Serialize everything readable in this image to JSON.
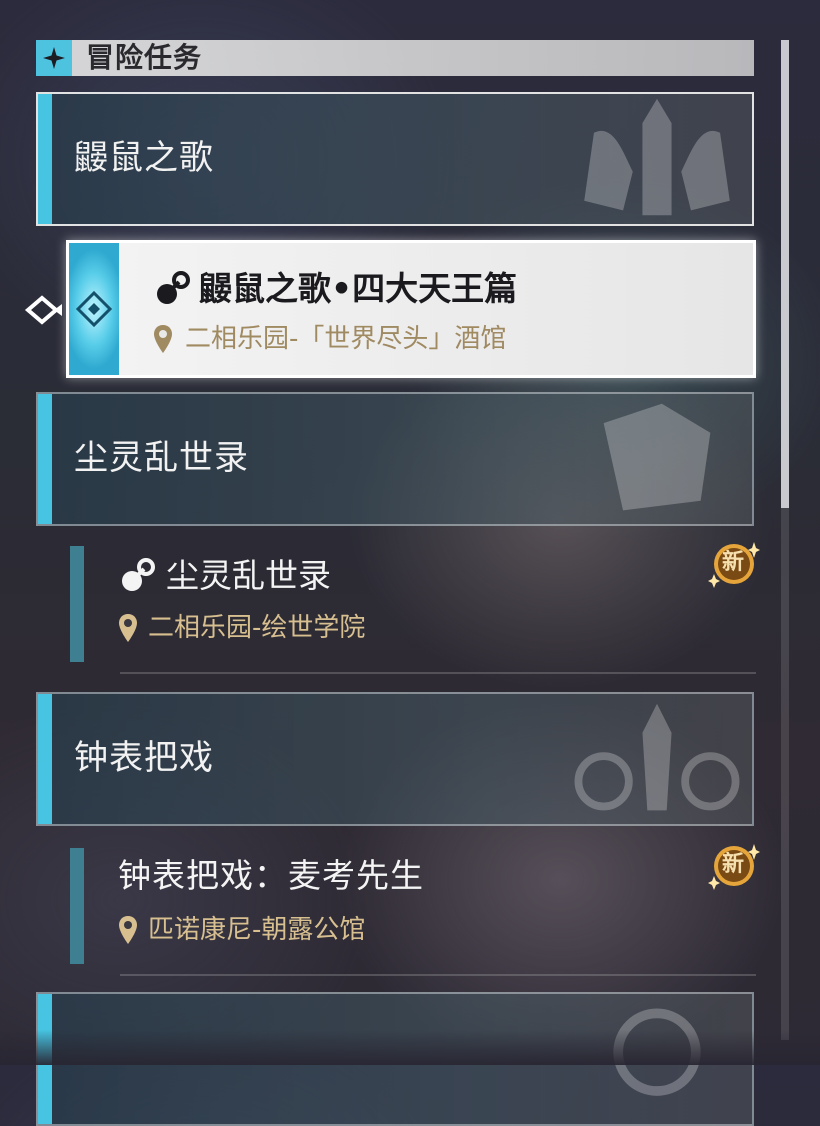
{
  "header": {
    "title": "冒险任务",
    "icon": "four-point-star-icon"
  },
  "colors": {
    "accent": "#46c4e2",
    "location": "#d7bf90",
    "badge": "#e6a53a"
  },
  "categories": [
    {
      "title": "鼹鼠之歌"
    },
    {
      "title": "尘灵乱世录"
    },
    {
      "title": "钟表把戏"
    },
    {
      "title": ""
    }
  ],
  "active_quest": {
    "title": "鼹鼠之歌•四大天王篇",
    "location": "二相乐园-「世界尽头」酒馆"
  },
  "quests": [
    {
      "title": "尘灵乱世录",
      "location": "二相乐园-绘世学院",
      "badge": "新"
    },
    {
      "title": "钟表把戏：麦考先生",
      "location": "匹诺康尼-朝露公馆",
      "badge": "新"
    }
  ]
}
